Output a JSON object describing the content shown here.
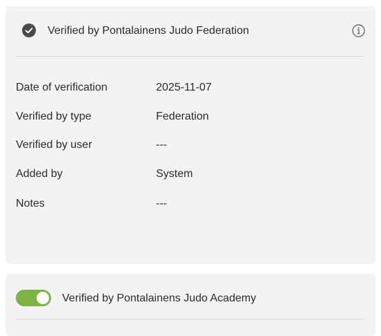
{
  "verification_card": {
    "title": "Verified by Pontalainens Judo Federation",
    "status_icon": "check-circle-icon",
    "info_icon": "info-icon",
    "details": [
      {
        "label": "Date of verification",
        "value": "2025-11-07"
      },
      {
        "label": "Verified by type",
        "value": "Federation"
      },
      {
        "label": "Verified by user",
        "value": "---"
      },
      {
        "label": "Added by",
        "value": "System"
      },
      {
        "label": "Notes",
        "value": "---"
      }
    ]
  },
  "academy_card": {
    "title": "Verified by Pontalainens Judo Academy",
    "toggle_on": true
  },
  "colors": {
    "card_bg": "#f3f3f3",
    "toggle_on": "#7cb342",
    "icon_dark": "#4a4a4a"
  }
}
